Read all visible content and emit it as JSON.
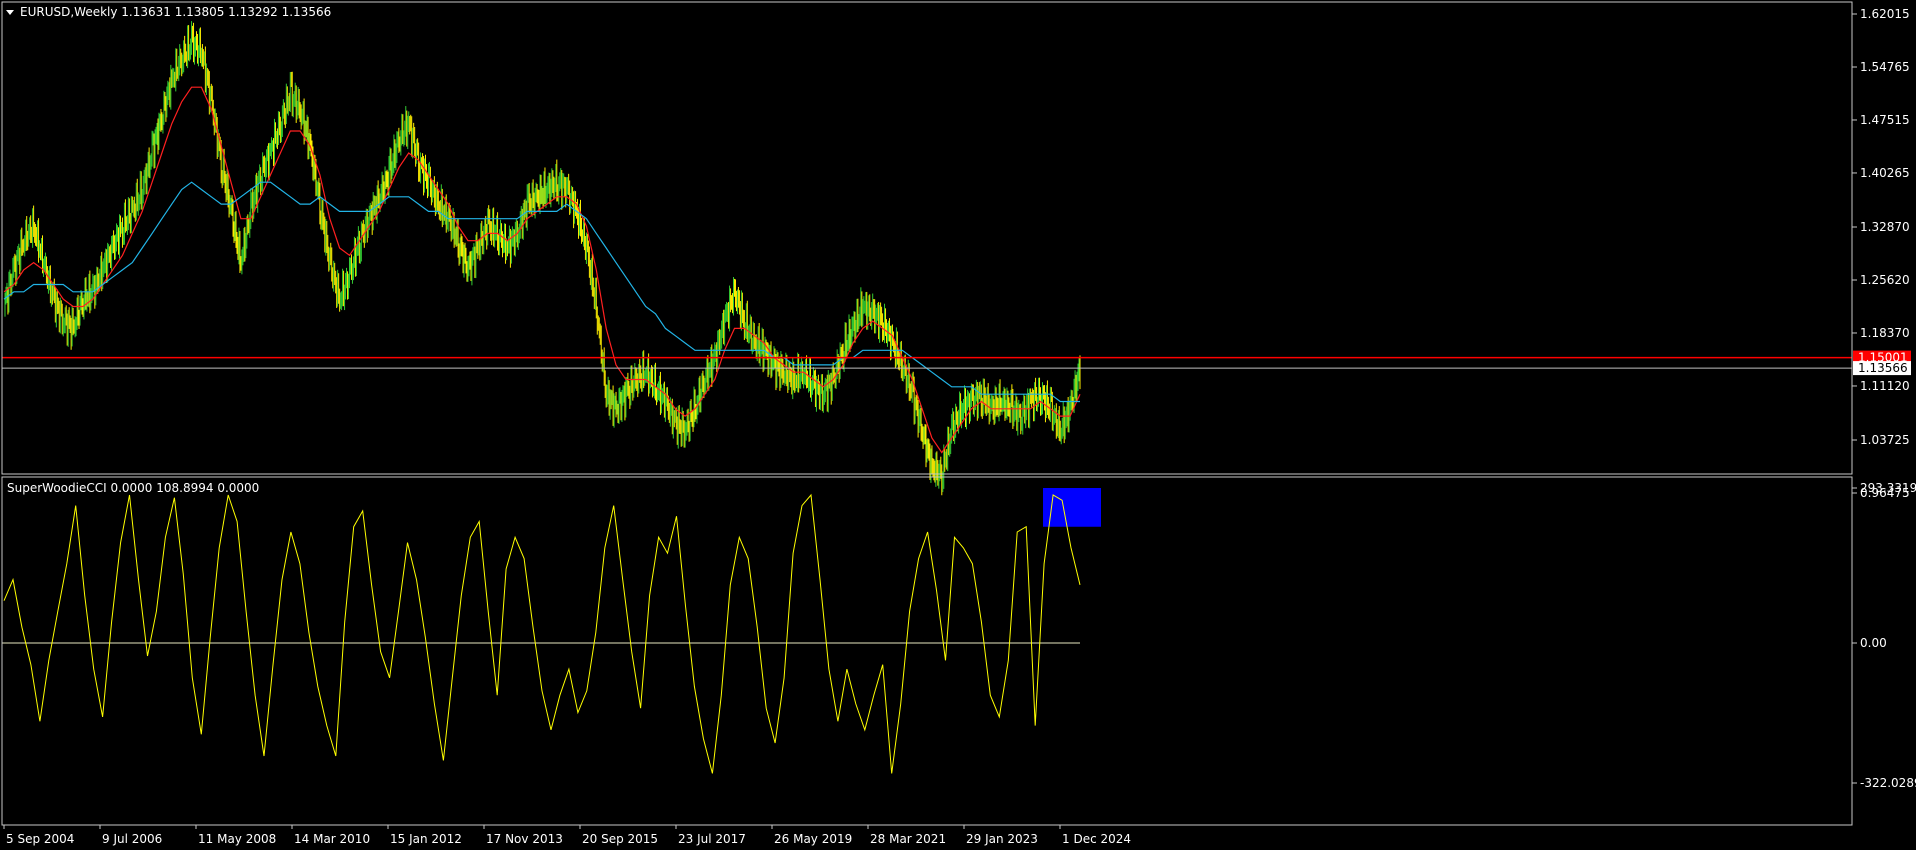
{
  "chart_header": {
    "symbol_line": "EURUSD,Weekly  1.13631 1.13805 1.13292 1.13566",
    "indicator_line": "SuperWoodieCCI 0.0000 108.8994 0.0000"
  },
  "colors": {
    "background": "#000000",
    "frame": "#c8c8c8",
    "bull_bars": "#33cc33",
    "bear_bars": "#ffee00",
    "ma_fast": "#ff2020",
    "ma_slow": "#22b4e6",
    "hline": "#ff0000",
    "current_line": "#c0c0c0",
    "cci_line": "#ffff00",
    "cci_highlight": "#0000ff",
    "axis_text": "#ffffff"
  },
  "price_axis": {
    "ticks": [
      "1.62015",
      "1.54765",
      "1.47515",
      "1.40265",
      "1.32870",
      "1.25620",
      "1.18370",
      "1.11120",
      "1.03725",
      "0.96475"
    ],
    "hline_label": "1.15001",
    "current_label": "1.13566"
  },
  "cci_axis": {
    "ticks": [
      "293.3319",
      "0.00",
      "-322.0289"
    ]
  },
  "time_axis": {
    "ticks": [
      "5 Sep 2004",
      "9 Jul 2006",
      "11 May 2008",
      "14 Mar 2010",
      "15 Jan 2012",
      "17 Nov 2013",
      "20 Sep 2015",
      "23 Jul 2017",
      "26 May 2019",
      "28 Mar 2021",
      "29 Jan 2023",
      "1 Dec 2024"
    ]
  },
  "chart_data": [
    {
      "type": "line",
      "title": "EURUSD,Weekly",
      "ylim": [
        0.93,
        1.63
      ],
      "x": [
        "5 Sep 2004",
        "9 Jul 2006",
        "11 May 2008",
        "14 Mar 2010",
        "15 Jan 2012",
        "17 Nov 2013",
        "20 Sep 2015",
        "23 Jul 2017",
        "26 May 2019",
        "28 Mar 2021",
        "29 Jan 2023",
        "1 Dec 2024"
      ],
      "ohlc_last": {
        "open": 1.13631,
        "high": 1.13805,
        "low": 1.13292,
        "close": 1.13566
      },
      "horizontal_line": 1.15001,
      "series": [
        {
          "values": [
            1.22,
            1.27,
            1.31,
            1.33,
            1.28,
            1.23,
            1.2,
            1.19,
            1.23,
            1.24,
            1.27,
            1.3,
            1.33,
            1.35,
            1.38,
            1.43,
            1.48,
            1.53,
            1.56,
            1.58,
            1.57,
            1.5,
            1.42,
            1.35,
            1.28,
            1.35,
            1.4,
            1.43,
            1.47,
            1.51,
            1.49,
            1.44,
            1.36,
            1.28,
            1.23,
            1.26,
            1.31,
            1.34,
            1.37,
            1.4,
            1.45,
            1.47,
            1.42,
            1.39,
            1.36,
            1.34,
            1.31,
            1.27,
            1.3,
            1.33,
            1.32,
            1.3,
            1.32,
            1.36,
            1.37,
            1.38,
            1.39,
            1.38,
            1.35,
            1.3,
            1.22,
            1.1,
            1.08,
            1.1,
            1.12,
            1.13,
            1.11,
            1.09,
            1.06,
            1.05,
            1.08,
            1.12,
            1.15,
            1.2,
            1.24,
            1.2,
            1.17,
            1.16,
            1.14,
            1.13,
            1.12,
            1.13,
            1.11,
            1.1,
            1.12,
            1.16,
            1.19,
            1.22,
            1.21,
            1.2,
            1.17,
            1.14,
            1.1,
            1.05,
            1.0,
            0.99,
            1.05,
            1.08,
            1.09,
            1.1,
            1.08,
            1.09,
            1.08,
            1.07,
            1.09,
            1.1,
            1.08,
            1.05,
            1.08,
            1.13566
          ]
        },
        {
          "values": [
            1.24,
            1.25,
            1.27,
            1.28,
            1.27,
            1.25,
            1.23,
            1.22,
            1.22,
            1.23,
            1.25,
            1.27,
            1.29,
            1.32,
            1.35,
            1.39,
            1.43,
            1.47,
            1.5,
            1.52,
            1.52,
            1.49,
            1.44,
            1.39,
            1.34,
            1.34,
            1.37,
            1.4,
            1.43,
            1.46,
            1.46,
            1.44,
            1.4,
            1.34,
            1.3,
            1.29,
            1.31,
            1.33,
            1.35,
            1.38,
            1.41,
            1.43,
            1.42,
            1.4,
            1.38,
            1.36,
            1.33,
            1.31,
            1.31,
            1.32,
            1.32,
            1.31,
            1.32,
            1.34,
            1.35,
            1.36,
            1.37,
            1.37,
            1.36,
            1.33,
            1.27,
            1.19,
            1.14,
            1.12,
            1.12,
            1.12,
            1.11,
            1.1,
            1.08,
            1.07,
            1.08,
            1.1,
            1.12,
            1.16,
            1.19,
            1.19,
            1.18,
            1.17,
            1.15,
            1.14,
            1.13,
            1.13,
            1.12,
            1.11,
            1.12,
            1.14,
            1.17,
            1.19,
            1.2,
            1.19,
            1.18,
            1.15,
            1.12,
            1.08,
            1.04,
            1.02,
            1.04,
            1.06,
            1.08,
            1.09,
            1.08,
            1.08,
            1.08,
            1.08,
            1.08,
            1.09,
            1.08,
            1.07,
            1.07,
            1.1
          ]
        },
        {
          "values": [
            1.23,
            1.24,
            1.24,
            1.25,
            1.25,
            1.25,
            1.25,
            1.24,
            1.24,
            1.24,
            1.25,
            1.26,
            1.27,
            1.28,
            1.3,
            1.32,
            1.34,
            1.36,
            1.38,
            1.39,
            1.38,
            1.37,
            1.36,
            1.36,
            1.37,
            1.38,
            1.39,
            1.39,
            1.38,
            1.37,
            1.36,
            1.36,
            1.37,
            1.36,
            1.35,
            1.35,
            1.35,
            1.35,
            1.36,
            1.37,
            1.37,
            1.37,
            1.36,
            1.35,
            1.35,
            1.34,
            1.34,
            1.34,
            1.34,
            1.34,
            1.34,
            1.34,
            1.34,
            1.35,
            1.35,
            1.35,
            1.35,
            1.36,
            1.35,
            1.34,
            1.32,
            1.3,
            1.28,
            1.26,
            1.24,
            1.22,
            1.21,
            1.19,
            1.18,
            1.17,
            1.16,
            1.16,
            1.16,
            1.16,
            1.16,
            1.16,
            1.16,
            1.16,
            1.15,
            1.15,
            1.14,
            1.14,
            1.14,
            1.14,
            1.14,
            1.15,
            1.15,
            1.16,
            1.16,
            1.16,
            1.16,
            1.16,
            1.15,
            1.14,
            1.13,
            1.12,
            1.11,
            1.11,
            1.11,
            1.1,
            1.1,
            1.1,
            1.1,
            1.1,
            1.1,
            1.1,
            1.1,
            1.09,
            1.09,
            1.09
          ]
        }
      ]
    },
    {
      "type": "line",
      "title": "SuperWoodieCCI",
      "ylim": [
        -322.0289,
        293.3319
      ],
      "zero_line": 0,
      "highlight_range": [
        220,
        293.3319
      ],
      "values": [
        80,
        120,
        30,
        -50,
        -180,
        -40,
        60,
        150,
        260,
        90,
        -60,
        -170,
        40,
        190,
        280,
        120,
        -30,
        60,
        200,
        275,
        130,
        -80,
        -210,
        10,
        180,
        280,
        230,
        60,
        -120,
        -260,
        -50,
        120,
        210,
        150,
        20,
        -100,
        -190,
        -260,
        40,
        220,
        250,
        110,
        -20,
        -80,
        60,
        190,
        120,
        10,
        -140,
        -270,
        -80,
        90,
        200,
        230,
        60,
        -120,
        140,
        200,
        160,
        30,
        -110,
        -200,
        -120,
        -60,
        -160,
        -110,
        20,
        180,
        260,
        120,
        -20,
        -150,
        90,
        200,
        170,
        240,
        70,
        -100,
        -220,
        -300,
        -120,
        110,
        200,
        160,
        30,
        -150,
        -230,
        -80,
        170,
        260,
        280,
        120,
        -60,
        -180,
        -60,
        -140,
        -200,
        -120,
        -50,
        -300,
        -140,
        60,
        160,
        210,
        100,
        -40,
        200,
        180,
        150,
        40,
        -120,
        -170,
        -40,
        210,
        220,
        -190,
        150,
        280,
        270,
        180,
        110
      ]
    }
  ]
}
